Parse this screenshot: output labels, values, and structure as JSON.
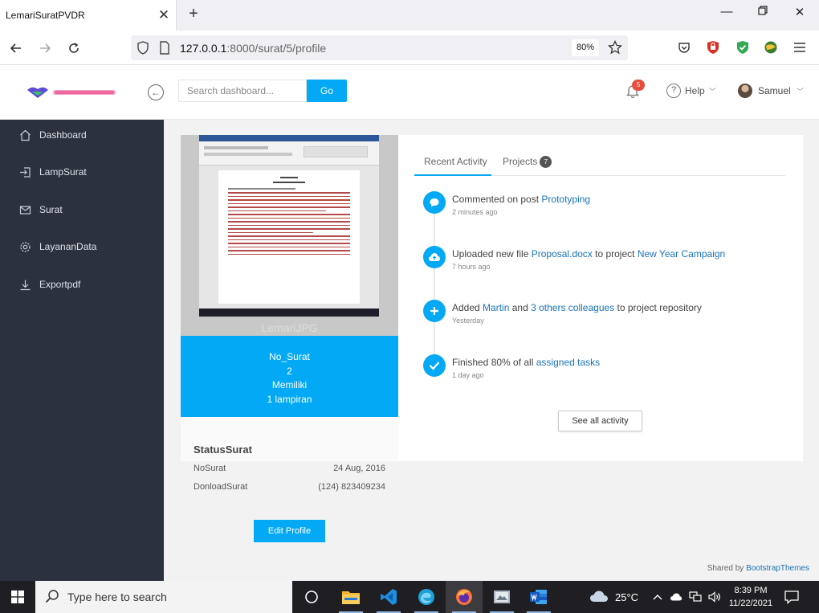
{
  "browser": {
    "tab_title": "LemariSuratPVDR",
    "url_host": "127.0.0.1",
    "url_path": ":8000/surat/5/profile",
    "zoom": "80%"
  },
  "header": {
    "search_placeholder": "Search dashboard...",
    "go_label": "Go",
    "notif_count": "5",
    "help_label": "Help",
    "user_name": "Samuel"
  },
  "sidebar": {
    "items": [
      {
        "label": "Dashboard",
        "icon": "home-icon"
      },
      {
        "label": "LampSurat",
        "icon": "login-icon"
      },
      {
        "label": "Surat",
        "icon": "mail-icon"
      },
      {
        "label": "LayananData",
        "icon": "gear-icon"
      },
      {
        "label": "Exportpdf",
        "icon": "download-icon"
      }
    ]
  },
  "profile": {
    "watermark": "LemariJPG",
    "info_lines": [
      "No_Surat",
      "2",
      "Memiliki",
      "1 lampiran"
    ],
    "status_title": "StatusSurat",
    "rows": [
      {
        "label": "NoSurat",
        "value": "24 Aug, 2016"
      },
      {
        "label": "DonloadSurat",
        "value": "(124) 823409234"
      }
    ],
    "edit_label": "Edit Profile"
  },
  "tabs": {
    "recent": "Recent Activity",
    "projects": "Projects",
    "projects_count": "7"
  },
  "activity": [
    {
      "pre": "Commented on post ",
      "link1": "Prototyping",
      "mid": "",
      "link2": "",
      "post": "",
      "time": "2 minutes ago",
      "icon": "comment-icon"
    },
    {
      "pre": "Uploaded new file ",
      "link1": "Proposal.docx",
      "mid": " to project ",
      "link2": "New Year Campaign",
      "post": "",
      "time": "7 hours ago",
      "icon": "cloud-upload-icon"
    },
    {
      "pre": "Added ",
      "link1": "Martin",
      "mid": " and ",
      "link2": "3 others colleagues",
      "post": " to project repository",
      "time": "Yesterday",
      "icon": "plus-icon"
    },
    {
      "pre": "Finished 80% of all ",
      "link1": "assigned tasks",
      "mid": "",
      "link2": "",
      "post": "",
      "time": "1 day ago",
      "icon": "check-icon"
    }
  ],
  "see_all_label": "See all activity",
  "footer": {
    "text": "Shared by ",
    "link": "BootstrapThemes"
  },
  "taskbar": {
    "search_placeholder": "Type here to search",
    "weather": "25°C",
    "time": "8:39 PM",
    "date": "11/22/2021"
  },
  "colors": {
    "accent": "#03a9f4",
    "sidebar": "#2b323d",
    "badge": "#e74c3c"
  }
}
